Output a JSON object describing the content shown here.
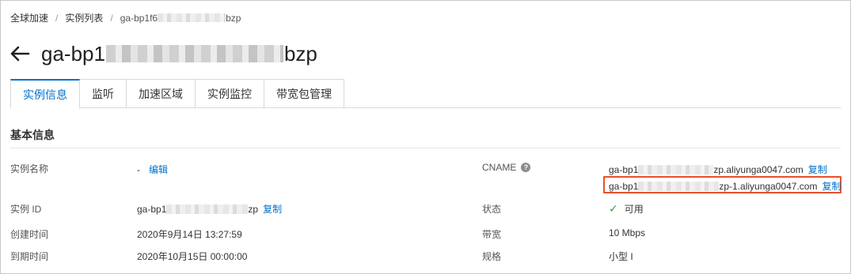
{
  "breadcrumb": {
    "items": [
      "全球加速",
      "实例列表"
    ],
    "current_prefix": "ga-bp1f6",
    "current_suffix": "bzp",
    "separator": "/"
  },
  "header": {
    "title_prefix": "ga-bp1",
    "title_suffix": "bzp",
    "back_icon": "arrow-left-icon"
  },
  "tabs": [
    {
      "label": "实例信息",
      "active": true
    },
    {
      "label": "监听",
      "active": false
    },
    {
      "label": "加速区域",
      "active": false
    },
    {
      "label": "实例监控",
      "active": false
    },
    {
      "label": "带宽包管理",
      "active": false
    }
  ],
  "section": {
    "title": "基本信息"
  },
  "fields": {
    "name": {
      "label": "实例名称",
      "value": "-",
      "action": "编辑"
    },
    "id": {
      "label": "实例 ID",
      "value_prefix": "ga-bp1",
      "value_suffix": "zp",
      "action": "复制"
    },
    "created": {
      "label": "创建时间",
      "value": "2020年9月14日 13:27:59"
    },
    "expires": {
      "label": "到期时间",
      "value": "2020年10月15日 00:00:00"
    },
    "cname": {
      "label": "CNAME",
      "help_icon": "question-circle-icon",
      "line1_prefix": "ga-bp1",
      "line1_suffix": "zp.aliyunga0047.com",
      "line2_prefix": "ga-bp1",
      "line2_suffix": "zp-1.aliyunga0047.com",
      "action": "复制"
    },
    "status": {
      "label": "状态",
      "value": "可用",
      "icon": "check-icon",
      "color": "#2da641"
    },
    "bandwidth": {
      "label": "带宽",
      "value": "10 Mbps"
    },
    "spec": {
      "label": "规格",
      "value": "小型 I"
    }
  },
  "colors": {
    "accent": "#0070cc",
    "highlight": "#e8502a"
  }
}
